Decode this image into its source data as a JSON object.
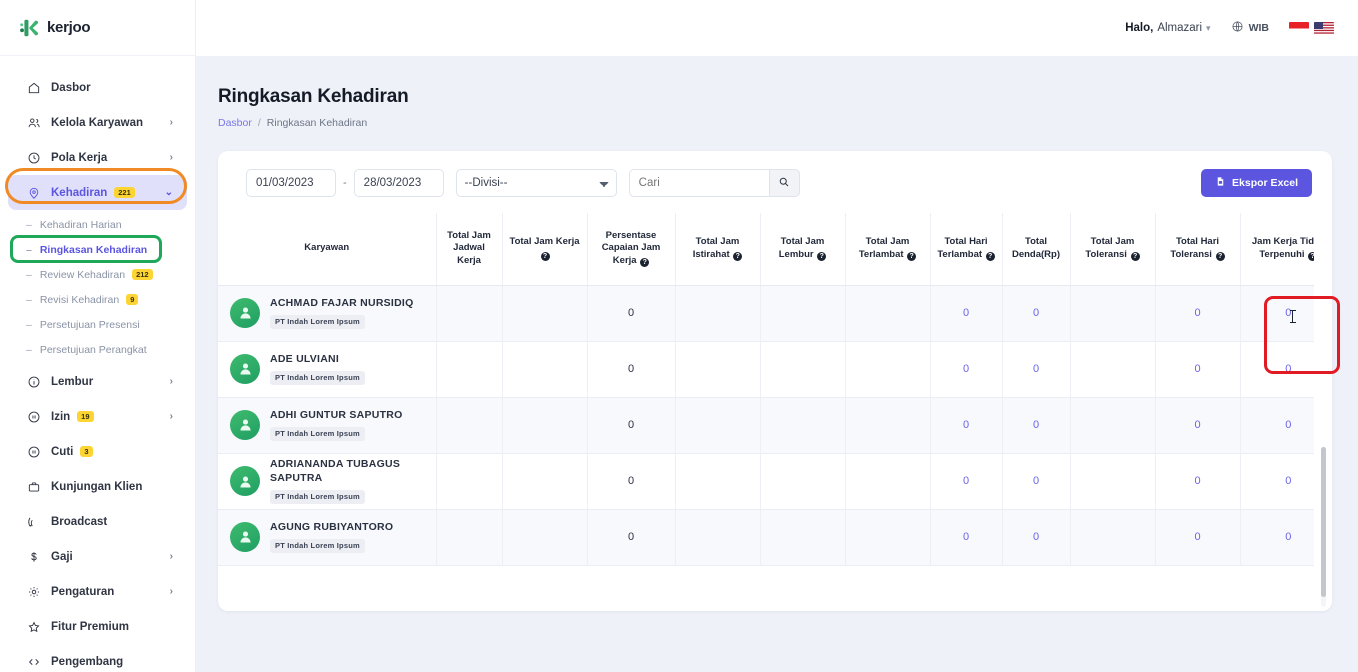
{
  "brand": {
    "name": "kerjoo",
    "color": "#2f9e63"
  },
  "header": {
    "greeting_prefix": "Halo,",
    "user_name": "Almazari",
    "timezone": "WIB",
    "flags": [
      "indonesia-flag",
      "usa-flag"
    ]
  },
  "sidebar": {
    "items": [
      {
        "label": "Dasbor",
        "icon": "home-icon",
        "badge": null,
        "chevron": false,
        "active": false
      },
      {
        "label": "Kelola Karyawan",
        "icon": "users-icon",
        "badge": null,
        "chevron": true,
        "active": false
      },
      {
        "label": "Pola Kerja",
        "icon": "clock-icon",
        "badge": null,
        "chevron": true,
        "active": false
      },
      {
        "label": "Kehadiran",
        "icon": "location-pin-icon",
        "badge": "221",
        "chevron": true,
        "active": true
      },
      {
        "label": "Lembur",
        "icon": "info-circle-icon",
        "badge": null,
        "chevron": true,
        "active": false
      },
      {
        "label": "Izin",
        "icon": "pause-circle-icon",
        "badge": "19",
        "chevron": true,
        "active": false
      },
      {
        "label": "Cuti",
        "icon": "pause-circle-icon",
        "badge": "3",
        "chevron": false,
        "active": false
      },
      {
        "label": "Kunjungan Klien",
        "icon": "briefcase-icon",
        "badge": null,
        "chevron": false,
        "active": false
      },
      {
        "label": "Broadcast",
        "icon": "broadcast-icon",
        "badge": null,
        "chevron": false,
        "active": false
      },
      {
        "label": "Gaji",
        "icon": "dollar-icon",
        "badge": null,
        "chevron": true,
        "active": false
      },
      {
        "label": "Pengaturan",
        "icon": "gear-icon",
        "badge": null,
        "chevron": true,
        "active": false
      },
      {
        "label": "Fitur Premium",
        "icon": "star-icon",
        "badge": null,
        "chevron": false,
        "active": false
      },
      {
        "label": "Pengembang",
        "icon": "code-icon",
        "badge": null,
        "chevron": false,
        "active": false
      }
    ],
    "submenu": [
      {
        "label": "Kehadiran Harian",
        "badge": null,
        "active": false
      },
      {
        "label": "Ringkasan Kehadiran",
        "badge": null,
        "active": true
      },
      {
        "label": "Review Kehadiran",
        "badge": "212",
        "active": false
      },
      {
        "label": "Revisi Kehadiran",
        "badge": "9",
        "active": false
      },
      {
        "label": "Persetujuan Presensi",
        "badge": null,
        "active": false
      },
      {
        "label": "Persetujuan Perangkat",
        "badge": null,
        "active": false
      }
    ]
  },
  "page": {
    "title": "Ringkasan Kehadiran",
    "breadcrumb": {
      "root": "Dasbor",
      "separator": "/",
      "current": "Ringkasan Kehadiran"
    }
  },
  "filters": {
    "date_start": "01/03/2023",
    "date_separator": "-",
    "date_end": "28/03/2023",
    "division_selected": "--Divisi--",
    "division_options": [
      "--Divisi--"
    ],
    "search_placeholder": "Cari",
    "search_value": "",
    "search_icon": "search-icon",
    "export_label": "Ekspor Excel",
    "export_icon": "excel-file-icon"
  },
  "table": {
    "columns": [
      {
        "label": "Karyawan",
        "help": false
      },
      {
        "label": "Total Jam Jadwal Kerja",
        "help": false
      },
      {
        "label": "Total Jam Kerja",
        "help": true
      },
      {
        "label": "Persentase Capaian Jam Kerja",
        "help": true
      },
      {
        "label": "Total Jam Istirahat",
        "help": true
      },
      {
        "label": "Total Jam Lembur",
        "help": true
      },
      {
        "label": "Total Jam Terlambat",
        "help": true
      },
      {
        "label": "Total Hari Terlambat",
        "help": true
      },
      {
        "label": "Total Denda(Rp)",
        "help": false
      },
      {
        "label": "Total Jam Toleransi",
        "help": true
      },
      {
        "label": "Total Hari Toleransi",
        "help": true
      },
      {
        "label": "Jam Kerja Tidak Terpenuhi",
        "help": true
      }
    ],
    "rows": [
      {
        "name": "ACHMAD FAJAR NURSIDIQ",
        "company": "PT Indah Lorem Ipsum",
        "jadwal": "",
        "jam_kerja": "",
        "persentase": "0",
        "istirahat": "",
        "lembur": "",
        "jam_terlambat": "",
        "hari_terlambat": "0",
        "denda": "0",
        "jam_toleransi": "",
        "hari_toleransi": "0",
        "tidak_terpenuhi": "0"
      },
      {
        "name": "ADE ULVIANI",
        "company": "PT Indah Lorem Ipsum",
        "jadwal": "",
        "jam_kerja": "",
        "persentase": "0",
        "istirahat": "",
        "lembur": "",
        "jam_terlambat": "",
        "hari_terlambat": "0",
        "denda": "0",
        "jam_toleransi": "",
        "hari_toleransi": "0",
        "tidak_terpenuhi": "0"
      },
      {
        "name": "ADHI GUNTUR SAPUTRO",
        "company": "PT Indah Lorem Ipsum",
        "jadwal": "",
        "jam_kerja": "",
        "persentase": "0",
        "istirahat": "",
        "lembur": "",
        "jam_terlambat": "",
        "hari_terlambat": "0",
        "denda": "0",
        "jam_toleransi": "",
        "hari_toleransi": "0",
        "tidak_terpenuhi": "0"
      },
      {
        "name": "ADRIANANDA TUBAGUS SAPUTRA",
        "company": "PT Indah Lorem Ipsum",
        "jadwal": "",
        "jam_kerja": "",
        "persentase": "0",
        "istirahat": "",
        "lembur": "",
        "jam_terlambat": "",
        "hari_terlambat": "0",
        "denda": "0",
        "jam_toleransi": "",
        "hari_toleransi": "0",
        "tidak_terpenuhi": "0"
      },
      {
        "name": "AGUNG RUBIYANTORO",
        "company": "PT Indah Lorem Ipsum",
        "jadwal": "",
        "jam_kerja": "",
        "persentase": "0",
        "istirahat": "",
        "lembur": "",
        "jam_terlambat": "",
        "hari_terlambat": "0",
        "denda": "0",
        "jam_toleransi": "",
        "hari_toleransi": "0",
        "tidak_terpenuhi": "0"
      }
    ]
  },
  "annotations": {
    "orange_highlight_target": "Kehadiran",
    "green_highlight_target": "Ringkasan Kehadiran",
    "red_highlight_target": "Jam Kerja Tidak Terpenuhi",
    "colors": {
      "orange": "#f08a24",
      "green": "#1fa85a",
      "red": "#e01b24",
      "accent": "#5b55e0"
    }
  }
}
